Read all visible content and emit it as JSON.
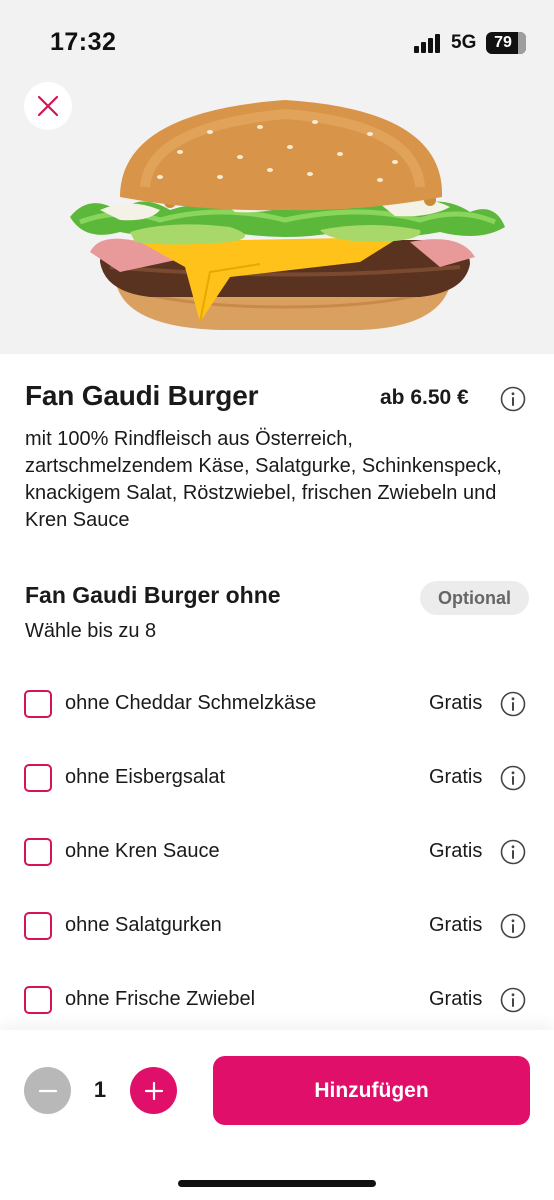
{
  "status_bar": {
    "time": "17:32",
    "network": "5G",
    "battery": "79"
  },
  "colors": {
    "accent": "#e0106a",
    "checkbox_border": "#d4145a",
    "disabled": "#b8b8b8"
  },
  "hero": {
    "image": "burger-photo",
    "close_icon": "close-icon"
  },
  "product": {
    "title": "Fan Gaudi Burger",
    "price": "ab 6.50 €",
    "description": "mit 100% Rindfleisch aus Österreich, zartschmelzendem Käse, Salatgurke, Schinkenspeck, knackigem Salat, Röstzwiebel, frischen Zwiebeln und Kren Sauce"
  },
  "options_section": {
    "title": "Fan Gaudi Burger ohne",
    "badge": "Optional",
    "subtitle": "Wähle bis zu 8",
    "items": [
      {
        "label": "ohne Cheddar Schmelzkäse",
        "price": "Gratis"
      },
      {
        "label": "ohne Eisbergsalat",
        "price": "Gratis"
      },
      {
        "label": "ohne Kren Sauce",
        "price": "Gratis"
      },
      {
        "label": "ohne Salatgurken",
        "price": "Gratis"
      },
      {
        "label": "ohne Frische Zwiebel",
        "price": "Gratis"
      }
    ]
  },
  "bottom_bar": {
    "quantity": "1",
    "add_label": "Hinzufügen"
  }
}
